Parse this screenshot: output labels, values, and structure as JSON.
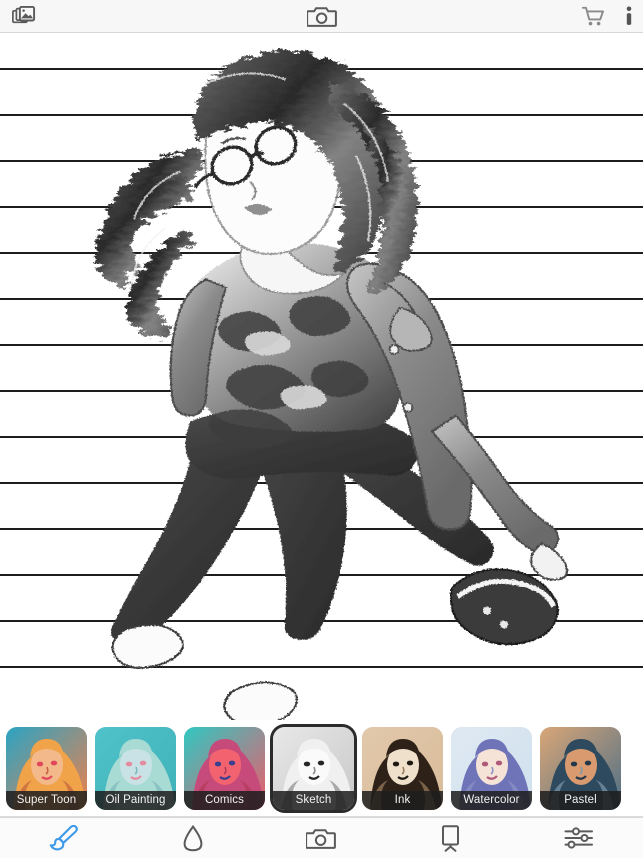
{
  "app": {
    "title": "Photo Sketch Filter Editor",
    "accent_color": "#3d9ae8",
    "icon_color": "#5a5a5a",
    "topbar_bg": "#f7f7f7",
    "label_bg": "#1e1e1e",
    "label_text_color": "#f2f2f2",
    "selected_border_color": "#2b2b2b"
  },
  "topbar": {
    "left": {
      "gallery": {
        "name": "gallery-icon",
        "label": "Gallery"
      }
    },
    "center": {
      "camera": {
        "name": "camera-icon",
        "label": "Camera"
      }
    },
    "right": {
      "cart": {
        "name": "cart-icon",
        "label": "Store"
      },
      "info": {
        "name": "info-icon",
        "label": "Info"
      }
    }
  },
  "canvas": {
    "description": "Sketch-filtered photo of a woman with glasses and long wavy hair wearing a denim jacket over a camouflage shirt and dark ripped jeans with white sneakers, kneeling against a horizontally planked wall",
    "background_style": "horizontal-plank-lines",
    "line_spacing_px": 46,
    "line_color": "#1d1d1d",
    "paper_color": "#ffffff",
    "active_filter": "Sketch"
  },
  "filters": {
    "selected_index": 3,
    "items": [
      {
        "label": "Super Toon",
        "name": "filter-thumb-super-toon",
        "palette": {
          "bg1": "#2aa4c4",
          "bg2": "#f0804a",
          "skin": "#f3b98a",
          "hair": "#f0a348",
          "accent": "#e0475c",
          "shadow": "#c4623f"
        },
        "selected": false
      },
      {
        "label": "Oil Painting",
        "name": "filter-thumb-oil-painting",
        "palette": {
          "bg1": "#4fc3c9",
          "bg2": "#3fb0b8",
          "skin": "#c9e2e6",
          "hair": "#a8dbd4",
          "accent": "#e58ba0",
          "shadow": "#7fb8bd"
        },
        "selected": false
      },
      {
        "label": "Comics",
        "name": "filter-thumb-comics",
        "palette": {
          "bg1": "#2fc8c2",
          "bg2": "#f05a6a",
          "skin": "#f2636f",
          "hair": "#c64a7a",
          "accent": "#3a3f8f",
          "shadow": "#b03a5a"
        },
        "selected": false
      },
      {
        "label": "Sketch",
        "name": "filter-thumb-sketch",
        "palette": {
          "bg1": "#e8e8e8",
          "bg2": "#c8c8c8",
          "skin": "#fafafa",
          "hair": "#f0f0f0",
          "accent": "#262626",
          "shadow": "#8a8a8a"
        },
        "selected": true
      },
      {
        "label": "Ink",
        "name": "filter-thumb-ink",
        "palette": {
          "bg1": "#e2c9ab",
          "bg2": "#d8bb9a",
          "skin": "#efe0cc",
          "hair": "#2e2218",
          "accent": "#1e1812",
          "shadow": "#9c7d5c"
        },
        "selected": false
      },
      {
        "label": "Watercolor",
        "name": "filter-thumb-watercolor",
        "palette": {
          "bg1": "#dfe9f2",
          "bg2": "#cfe0ee",
          "skin": "#f6e3d8",
          "hair": "#6f74b8",
          "accent": "#b05a7a",
          "shadow": "#8d93c6"
        },
        "selected": false
      },
      {
        "label": "Pastel",
        "name": "filter-thumb-pastel",
        "palette": {
          "bg1": "#d9a677",
          "bg2": "#4e6f86",
          "skin": "#d89a6e",
          "hair": "#2e4a5e",
          "accent": "#23384a",
          "shadow": "#7d99ad"
        },
        "selected": false
      }
    ]
  },
  "bottombar": {
    "selected_index": 0,
    "items": [
      {
        "label": "Effects",
        "name": "tab-effects",
        "icon": "brush-icon",
        "selected": true
      },
      {
        "label": "Blend",
        "name": "tab-blend",
        "icon": "droplet-icon",
        "selected": false
      },
      {
        "label": "Camera",
        "name": "tab-camera",
        "icon": "camera-icon",
        "selected": false
      },
      {
        "label": "Canvas",
        "name": "tab-canvas",
        "icon": "easel-icon",
        "selected": false
      },
      {
        "label": "Adjust",
        "name": "tab-adjust",
        "icon": "sliders-icon",
        "selected": false
      }
    ]
  }
}
